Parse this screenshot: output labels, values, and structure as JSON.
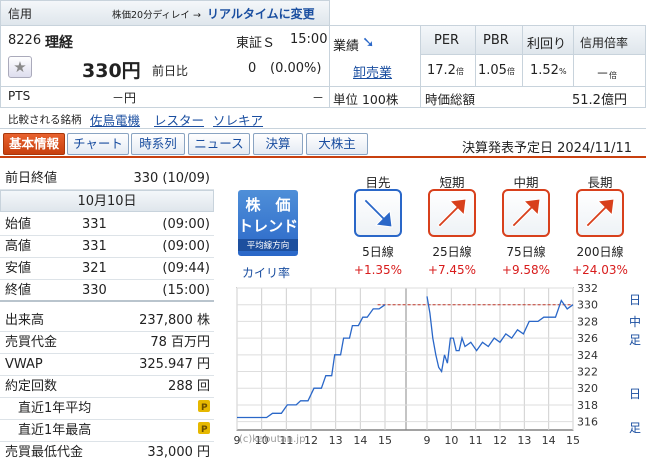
{
  "header": {
    "market_label": "信用",
    "delay_text": "株価20分ディレイ →",
    "realtime_link": "リアルタイムに変更",
    "code": "8226",
    "name": "理経",
    "exchange": "東証Ｓ",
    "time": "15:00",
    "price": "330円",
    "change_label": "前日比",
    "change_value": "0",
    "change_pct": "(0.00%)",
    "pts_label": "PTS",
    "pts_value": "－円",
    "pts_change": "－"
  },
  "gyoseki": {
    "label": "業績",
    "sector_link": "卸売業",
    "unit": "単位 100株"
  },
  "metrics": {
    "headers": [
      "PER",
      "PBR",
      "利回り",
      "信用倍率"
    ],
    "values": [
      "17.2",
      "1.05",
      "1.52",
      "－"
    ],
    "units": [
      "倍",
      "倍",
      "%",
      "倍"
    ],
    "market_cap_label": "時価総額",
    "market_cap_value": "51.2億円"
  },
  "compare": {
    "label": "比較される銘柄",
    "items": [
      "佐鳥電機",
      "レスター",
      "ソレキア"
    ]
  },
  "tabs": [
    "基本情報",
    "チャート",
    "時系列",
    "ニュース",
    "決算",
    "大株主"
  ],
  "kessan": "決算発表予定日  2024/11/11",
  "left": {
    "prev_close_label": "前日終値",
    "prev_close_value": "330 (10/09)",
    "date_header": "10月10日",
    "ohlc": [
      {
        "label": "始値",
        "value": "331",
        "time": "(09:00)"
      },
      {
        "label": "高値",
        "value": "331",
        "time": "(09:00)"
      },
      {
        "label": "安値",
        "value": "321",
        "time": "(09:44)"
      },
      {
        "label": "終値",
        "value": "330",
        "time": "(15:00)"
      }
    ],
    "stats": [
      {
        "label": "出来高",
        "value": "237,800 株"
      },
      {
        "label": "売買代金",
        "value": "78 百万円"
      },
      {
        "label": "VWAP",
        "value": "325.947 円"
      },
      {
        "label": "約定回数",
        "value": "288 回"
      }
    ],
    "avg_label": "直近1年平均",
    "max_label": "直近1年最高",
    "min_trade_label": "売買最低代金",
    "min_trade_value": "33,000 円"
  },
  "trend": {
    "logo_line1": "株　価",
    "logo_line2": "トレンド",
    "logo_sub": "平均線方向",
    "kairi": "カイリ率",
    "columns": [
      {
        "head": "目先",
        "ma": "5日線",
        "pct": "+1.35",
        "dir": "down",
        "color": "#2a67c8"
      },
      {
        "head": "短期",
        "ma": "25日線",
        "pct": "+7.45",
        "dir": "up",
        "color": "#d8401c"
      },
      {
        "head": "中期",
        "ma": "75日線",
        "pct": "+9.58",
        "dir": "up",
        "color": "#d8401c"
      },
      {
        "head": "長期",
        "ma": "200日線",
        "pct": "+24.03",
        "dir": "up",
        "color": "#d8401c"
      }
    ],
    "pct_unit": "%"
  },
  "chart_data": {
    "type": "line",
    "ylim": [
      315,
      332
    ],
    "y_ticks": [
      316,
      318,
      320,
      322,
      324,
      326,
      328,
      330,
      332
    ],
    "x_ticks_left": [
      "9",
      "10",
      "11",
      "12",
      "13",
      "14",
      "15"
    ],
    "x_ticks_right": [
      "9",
      "10",
      "11",
      "12",
      "13",
      "14",
      "15"
    ],
    "prev_close": 330,
    "watermark": "(c)kabutan.jp",
    "side_labels": [
      "日",
      "中",
      "足"
    ],
    "side_label2": "日",
    "side_label3": "足",
    "series_day1": [
      [
        0.0,
        316.5
      ],
      [
        0.2,
        316.5
      ],
      [
        0.24,
        317.0
      ],
      [
        0.3,
        317.0
      ],
      [
        0.34,
        318.0
      ],
      [
        0.4,
        318.0
      ],
      [
        0.43,
        318.5
      ],
      [
        0.48,
        318.5
      ],
      [
        0.52,
        320.0
      ],
      [
        0.57,
        320.0
      ],
      [
        0.6,
        321.5
      ],
      [
        0.64,
        321.5
      ],
      [
        0.66,
        324.0
      ],
      [
        0.7,
        324.0
      ],
      [
        0.72,
        326.0
      ],
      [
        0.76,
        326.0
      ],
      [
        0.78,
        327.5
      ],
      [
        0.82,
        327.5
      ],
      [
        0.85,
        328.5
      ],
      [
        0.88,
        328.5
      ],
      [
        0.92,
        329.5
      ],
      [
        0.96,
        329.5
      ],
      [
        1.0,
        330.0
      ]
    ],
    "series_day2": [
      [
        0.0,
        331.0
      ],
      [
        0.02,
        329.0
      ],
      [
        0.04,
        326.0
      ],
      [
        0.06,
        324.0
      ],
      [
        0.08,
        322.5
      ],
      [
        0.1,
        322.0
      ],
      [
        0.12,
        324.0
      ],
      [
        0.14,
        323.0
      ],
      [
        0.16,
        326.0
      ],
      [
        0.18,
        326.0
      ],
      [
        0.2,
        324.5
      ],
      [
        0.22,
        324.5
      ],
      [
        0.24,
        326.0
      ],
      [
        0.26,
        325.0
      ],
      [
        0.3,
        325.5
      ],
      [
        0.34,
        324.5
      ],
      [
        0.38,
        325.5
      ],
      [
        0.42,
        325.0
      ],
      [
        0.46,
        326.0
      ],
      [
        0.5,
        325.5
      ],
      [
        0.54,
        326.5
      ],
      [
        0.58,
        326.0
      ],
      [
        0.62,
        327.0
      ],
      [
        0.66,
        326.5
      ],
      [
        0.7,
        328.0
      ],
      [
        0.76,
        328.0
      ],
      [
        0.8,
        328.5
      ],
      [
        0.88,
        328.5
      ],
      [
        0.92,
        330.5
      ],
      [
        0.96,
        329.5
      ],
      [
        1.0,
        330.0
      ]
    ],
    "line_color": "#2a67c8",
    "prev_color": "#c0392b"
  }
}
